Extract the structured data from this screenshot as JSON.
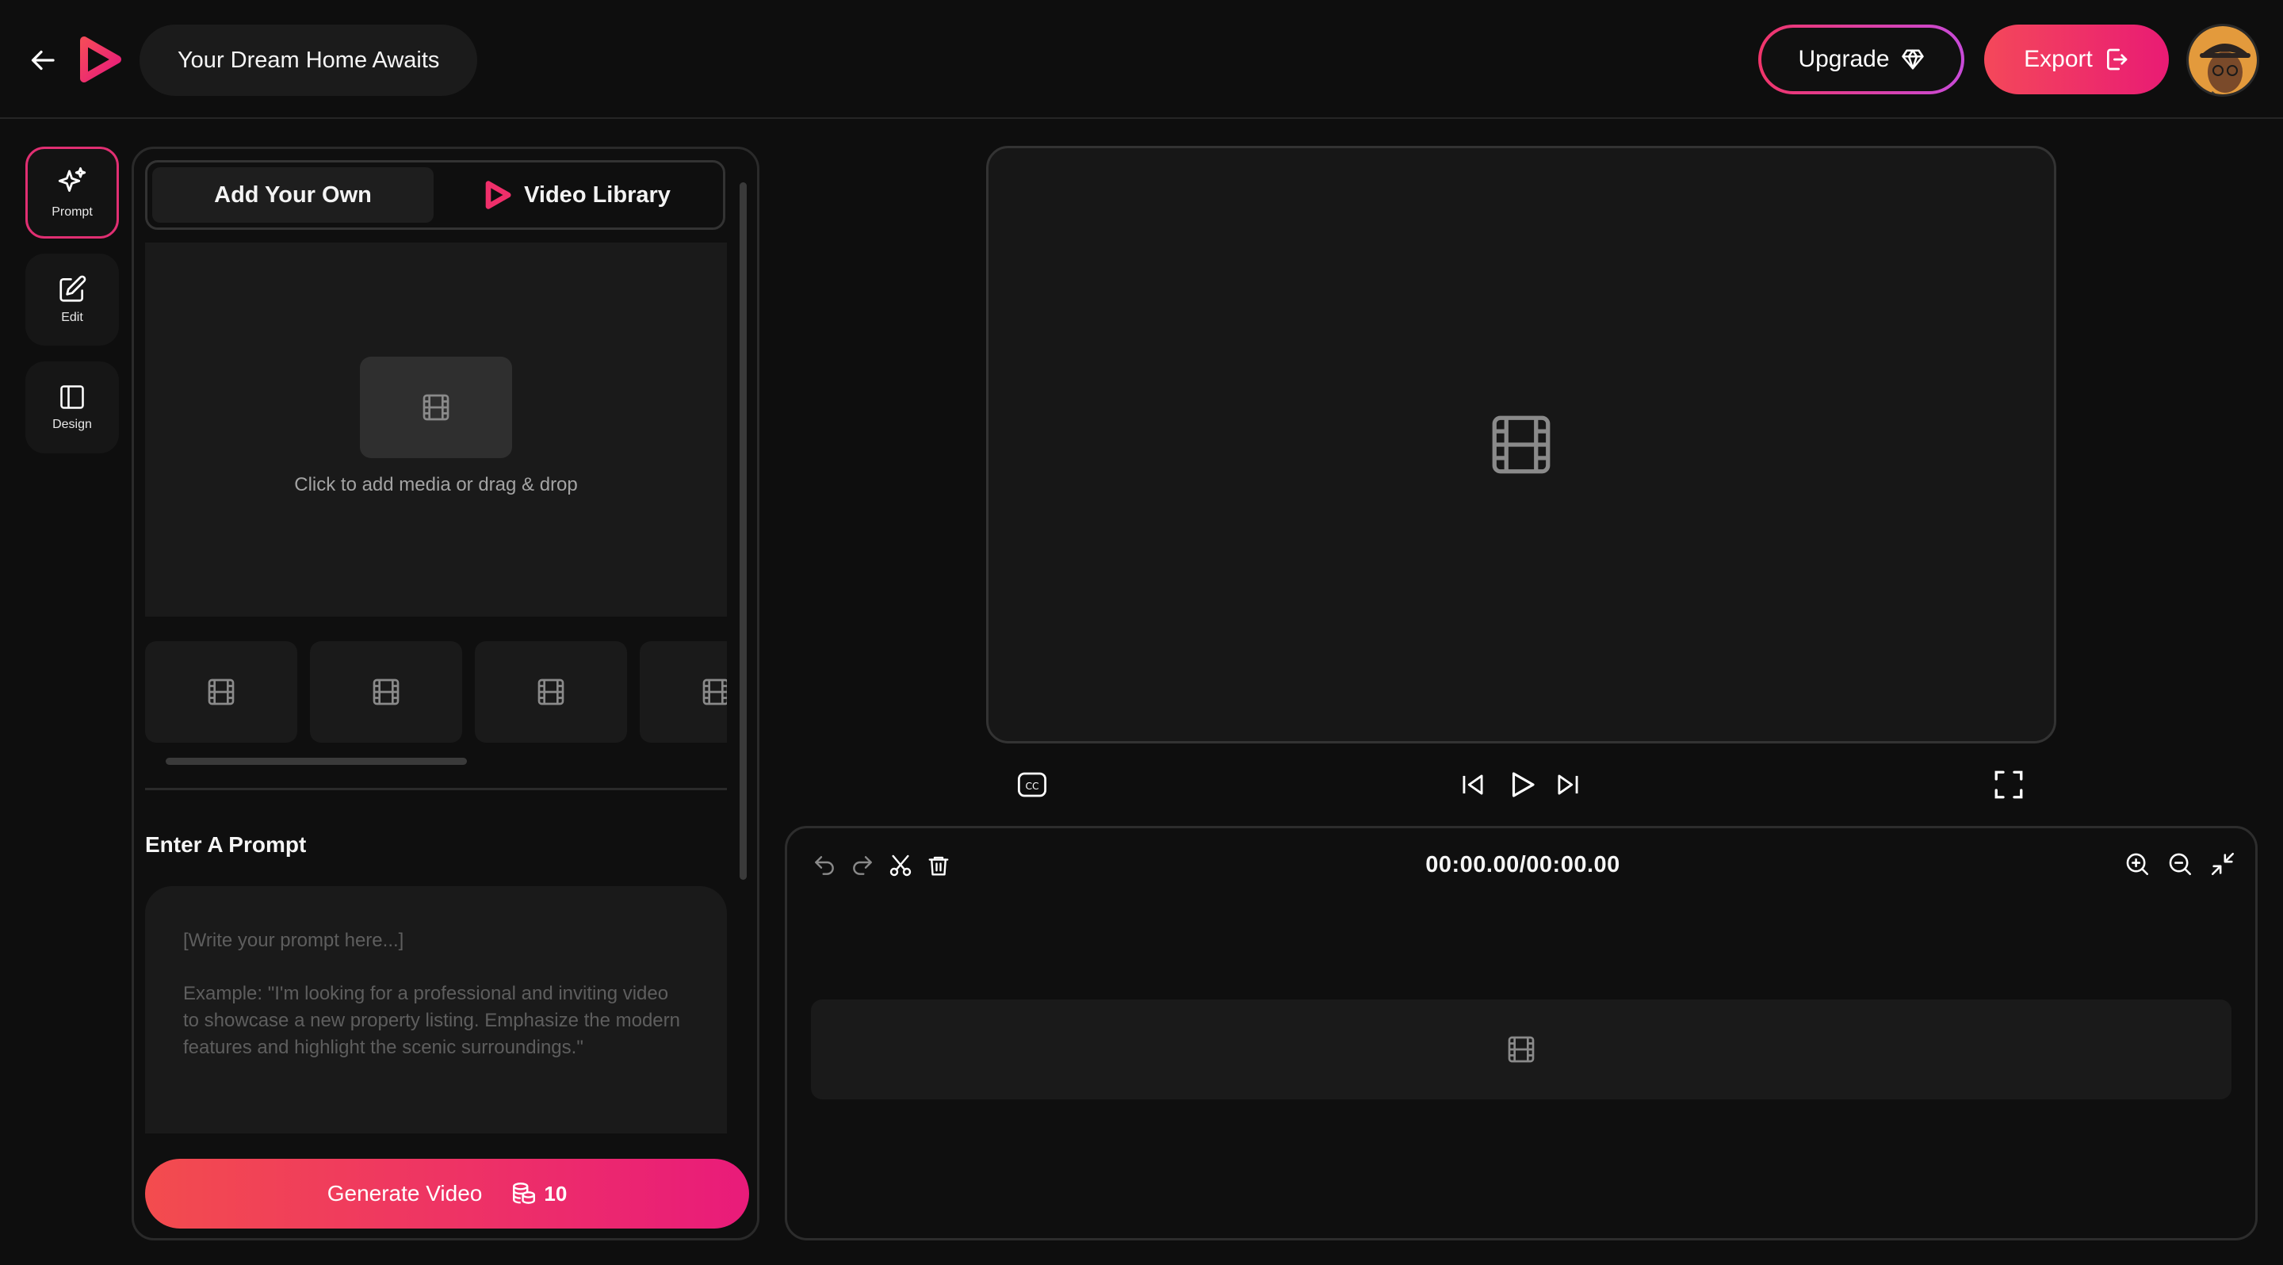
{
  "header": {
    "project_title": "Your Dream Home Awaits",
    "upgrade_label": "Upgrade",
    "export_label": "Export"
  },
  "rail": {
    "items": [
      {
        "label": "Prompt",
        "icon": "sparkle-icon",
        "active": true
      },
      {
        "label": "Edit",
        "icon": "edit-icon",
        "active": false
      },
      {
        "label": "Design",
        "icon": "layout-icon",
        "active": false
      }
    ]
  },
  "media_panel": {
    "tabs": [
      {
        "label": "Add Your Own",
        "active": true
      },
      {
        "label": "Video Library",
        "active": false
      }
    ],
    "drop_text": "Click to add media or drag & drop",
    "thumbnail_count": 4
  },
  "prompt": {
    "heading": "Enter A Prompt",
    "placeholder_line1": "[Write your prompt here...]",
    "placeholder_example": "Example: \"I'm looking for a professional and inviting video to showcase a new property listing. Emphasize the modern features and highlight the scenic surroundings.\"",
    "generate_label": "Generate Video",
    "credits": "10"
  },
  "player": {
    "cc_label": "CC"
  },
  "timeline": {
    "time_display": "00:00.00/00:00.00"
  },
  "colors": {
    "accent_start": "#f34c4e",
    "accent_end": "#e91b7a",
    "background": "#0e0e0e",
    "surface": "#1a1a1a"
  }
}
